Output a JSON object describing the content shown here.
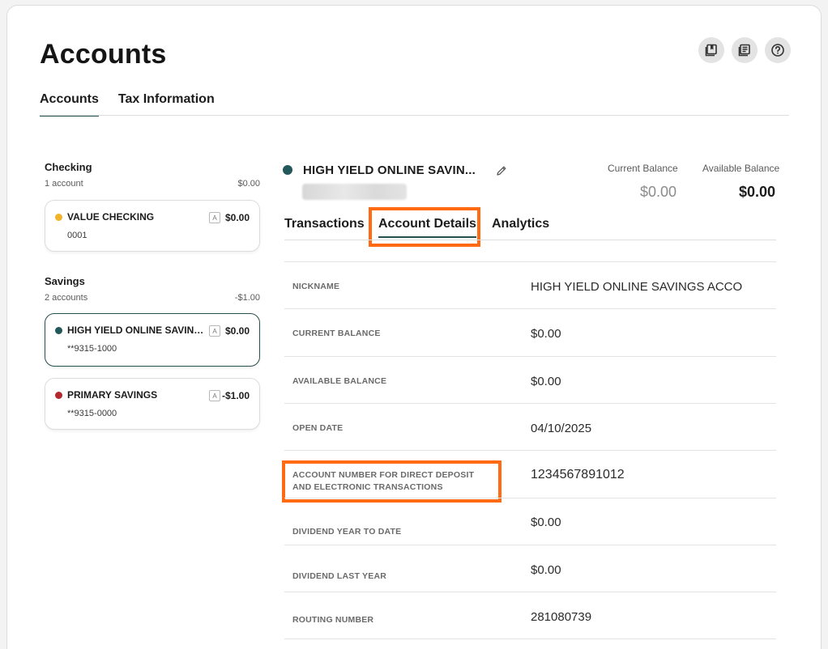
{
  "page": {
    "title": "Accounts"
  },
  "top_icons": [
    "bookmark-icon",
    "list-icon",
    "help-icon"
  ],
  "main_tabs": [
    {
      "label": "Accounts",
      "active": true
    },
    {
      "label": "Tax Information",
      "active": false
    }
  ],
  "sidebar": {
    "checking": {
      "title": "Checking",
      "count": "1 account",
      "total": "$0.00",
      "accounts": [
        {
          "name": "VALUE CHECKING",
          "number": "0001",
          "badge": "A",
          "balance": "$0.00",
          "dot_color": "#f2b32a"
        }
      ]
    },
    "savings": {
      "title": "Savings",
      "count": "2 accounts",
      "total": "-$1.00",
      "accounts": [
        {
          "name": "HIGH YIELD ONLINE SAVINGS ACCOUNT",
          "number": "**9315-1000",
          "badge": "A",
          "balance": "$0.00",
          "dot_color": "#22585a"
        },
        {
          "name": "PRIMARY SAVINGS",
          "number": "**9315-0000",
          "badge": "A",
          "balance": "-$1.00",
          "dot_color": "#b3272d"
        }
      ]
    }
  },
  "detail": {
    "title": "HIGH YIELD ONLINE SAVIN...",
    "current_balance_label": "Current Balance",
    "current_balance": "$0.00",
    "available_balance_label": "Available Balance",
    "available_balance": "$0.00",
    "tabs": [
      "Transactions",
      "Account Details",
      "Analytics"
    ],
    "rows": [
      {
        "label": "NICKNAME",
        "value": "HIGH YIELD ONLINE SAVINGS ACCO"
      },
      {
        "label": "CURRENT BALANCE",
        "value": "$0.00"
      },
      {
        "label": "AVAILABLE BALANCE",
        "value": "$0.00"
      },
      {
        "label": "OPEN DATE",
        "value": "04/10/2025"
      },
      {
        "label": "ACCOUNT NUMBER FOR DIRECT DEPOSIT AND ELECTRONIC TRANSACTIONS",
        "value": "1234567891012"
      },
      {
        "label": "DIVIDEND YEAR TO DATE",
        "value": "$0.00"
      },
      {
        "label": "DIVIDEND LAST YEAR",
        "value": "$0.00"
      },
      {
        "label": "ROUTING NUMBER",
        "value": "281080739"
      }
    ]
  },
  "colors": {
    "accent": "#24514d",
    "highlight": "#ff6a13"
  }
}
